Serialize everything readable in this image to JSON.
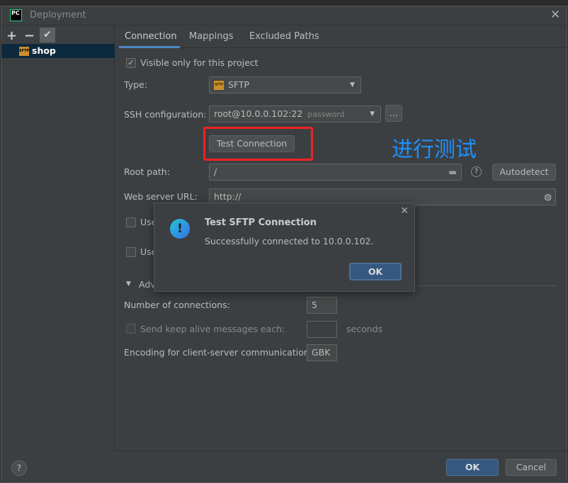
{
  "window": {
    "title": "Deployment",
    "logo": "PC"
  },
  "sidebar": {
    "add": "+",
    "remove": "−",
    "check": "✔",
    "servers": [
      {
        "name": "shop",
        "icon": "sftp-icon"
      }
    ]
  },
  "tabs": [
    {
      "label": "Connection",
      "active": true
    },
    {
      "label": "Mappings"
    },
    {
      "label": "Excluded Paths"
    }
  ],
  "form": {
    "visible_only": "Visible only for this project",
    "type_label": "Type:",
    "type_value": "SFTP",
    "ssh_label": "SSH configuration:",
    "ssh_value": "root@10.0.0.102:22",
    "ssh_auth": "password",
    "ssh_more": "...",
    "test_button": "Test Connection",
    "root_label": "Root path:",
    "root_value": "/",
    "autodetect": "Autodetect",
    "web_label": "Web server URL:",
    "web_value": "http://",
    "use1": "Use",
    "use2": "Use",
    "advanced": "Adv",
    "conn_label": "Number of connections:",
    "conn_value": "5",
    "keepalive_label": "Send keep alive messages each:",
    "keepalive_unit": "seconds",
    "encoding_label": "Encoding for client-server communication:",
    "encoding_value": "GBK"
  },
  "annotation": "进行测试",
  "popup": {
    "title": "Test SFTP Connection",
    "message": "Successfully connected to 10.0.0.102.",
    "ok": "OK"
  },
  "footer": {
    "help": "?",
    "ok": "OK",
    "cancel": "Cancel"
  },
  "colors": {
    "accent": "#4a88c7",
    "highlight": "#ee2222",
    "annotation": "#1e90ff"
  }
}
